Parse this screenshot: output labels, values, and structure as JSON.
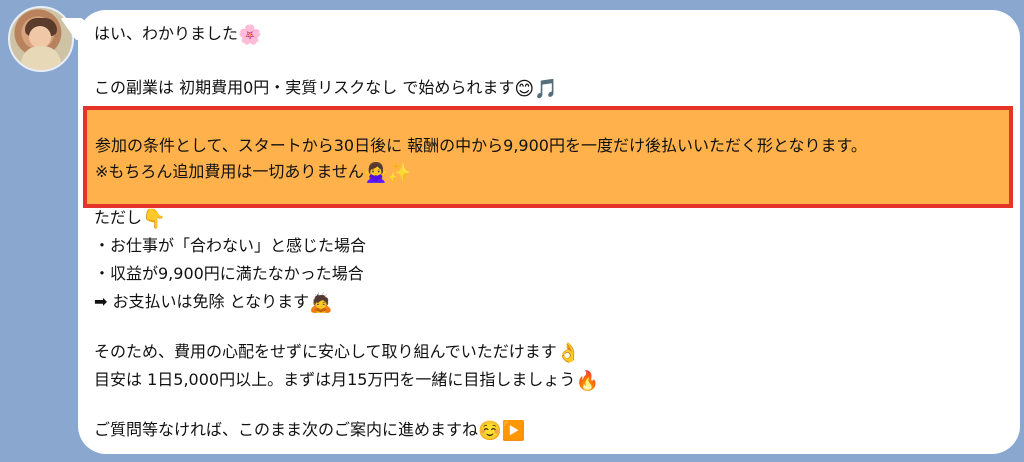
{
  "message": {
    "lines": [
      "はい、わかりました",
      "この副業は 初期費用0円・実質リスクなし で始められます",
      "参加の条件として、スタートから30日後に 報酬の中から9,900円を一度だけ後払いいただく形となります。",
      "※もちろん追加費用は一切ありません",
      "ただし",
      "・お仕事が「合わない」と感じた場合",
      "・収益が9,900円に満たなかった場合",
      "➡ お支払いは免除 となります",
      "そのため、費用の心配をせずに安心して取り組んでいただけます",
      "目安は 1日5,000円以上。まずは月15万円を一緒に目指しましょう",
      "ご質問等なければ、このまま次のご案内に進めますね"
    ],
    "emoji": {
      "blossom": "🌸",
      "smile": "😊",
      "music": "🎵",
      "person": "🙅‍♀️",
      "sparkles": "✨",
      "point_down": "👇",
      "bow": "🙇",
      "ok_hand": "👌",
      "fire": "🔥",
      "relieved": "☺️",
      "play": "▶️"
    }
  },
  "colors": {
    "chat_background": "#8aa7cf",
    "bubble": "#ffffff",
    "highlight_fill": "#ffb14b",
    "highlight_border": "#e6332a"
  }
}
